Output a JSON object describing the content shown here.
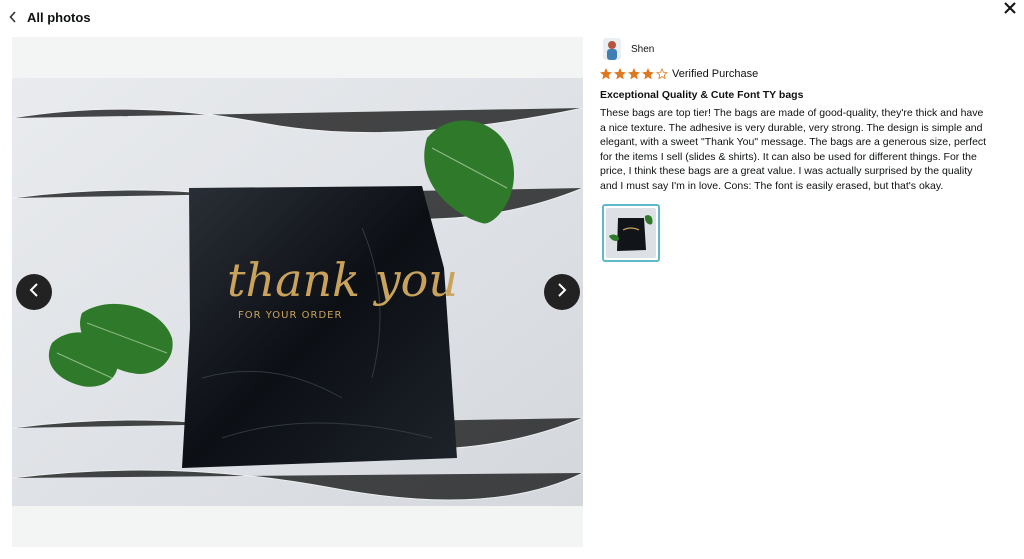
{
  "header": {
    "back_label": "All photos"
  },
  "photo": {
    "script_main": "thank you",
    "script_sub": "FOR YOUR ORDER"
  },
  "review": {
    "author": "Shen",
    "rating": 4,
    "rating_max": 5,
    "verified": "Verified Purchase",
    "title": "Exceptional Quality & Cute Font TY bags",
    "body": "These bags are top tier! The bags are made of good-quality, they're thick and have a nice texture. The adhesive is very durable, very strong. The design is simple and elegant, with a sweet \"Thank You\" message. The bags are a generous size, perfect for the items I sell (slides & shirts). It can also be used for different things. For the price, I think these bags are a great value. I was actually surprised by the quality and I must say I'm in love. Cons: The font is easily erased, but that's okay."
  },
  "colors": {
    "star": "#de7921",
    "thumb_border": "#5fb9c8",
    "nav_bg": "#222222"
  }
}
